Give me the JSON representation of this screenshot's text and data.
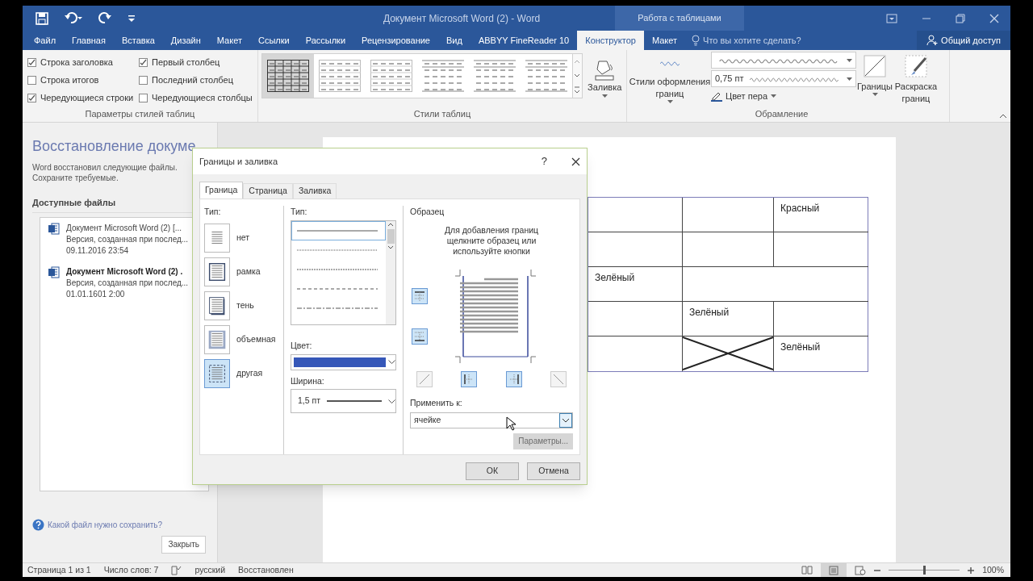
{
  "title_bar": {
    "title": "Документ Microsoft Word (2) - Word",
    "context_tab": "Работа с таблицами"
  },
  "ribbon_tabs": [
    {
      "label": "Файл",
      "selected": false
    },
    {
      "label": "Главная",
      "selected": false
    },
    {
      "label": "Вставка",
      "selected": false
    },
    {
      "label": "Дизайн",
      "selected": false
    },
    {
      "label": "Макет",
      "selected": false
    },
    {
      "label": "Ссылки",
      "selected": false
    },
    {
      "label": "Рассылки",
      "selected": false
    },
    {
      "label": "Рецензирование",
      "selected": false
    },
    {
      "label": "Вид",
      "selected": false
    },
    {
      "label": "ABBYY FineReader 10",
      "selected": false
    },
    {
      "label": "Конструктор",
      "selected": true
    },
    {
      "label": "Макет",
      "selected": false
    }
  ],
  "tell_me": "Что вы хотите сделать?",
  "share": "Общий доступ",
  "style_options": {
    "label": "Параметры стилей таблиц",
    "checkboxes": [
      {
        "label": "Строка заголовка",
        "checked": true
      },
      {
        "label": "Строка итогов",
        "checked": false
      },
      {
        "label": "Чередующиеся строки",
        "checked": true
      },
      {
        "label": "Первый столбец",
        "checked": true
      },
      {
        "label": "Последний столбец",
        "checked": false
      },
      {
        "label": "Чередующиеся столбцы",
        "checked": false
      }
    ]
  },
  "table_styles": {
    "label": "Стили таблиц",
    "items": [
      {
        "selected": true
      },
      {
        "selected": false
      },
      {
        "selected": false
      },
      {
        "selected": false
      },
      {
        "selected": false
      },
      {
        "selected": false
      }
    ]
  },
  "shading": {
    "label": "Заливка"
  },
  "borders_group": {
    "label": "Обрамление",
    "border_styles": "Стили оформления границ",
    "pen_weight": "0,75 пт",
    "pen_color": "Цвет пера",
    "borders": "Границы",
    "border_painter": "Раскраска границ"
  },
  "recovery": {
    "title": "Восстановление докуме",
    "description": "Word восстановил следующие файлы. Сохраните требуемые.",
    "files_label": "Доступные файлы",
    "files": [
      {
        "name": "Документ Microsoft Word (2)  [...",
        "detail": "Версия, созданная при послед...",
        "date": "09.11.2016 23:54",
        "selected": false
      },
      {
        "name": "Документ Microsoft Word (2) .",
        "detail": "Версия, созданная при послед...",
        "date": "01.01.1601 2:00",
        "selected": true
      }
    ],
    "help": "Какой файл нужно сохранить?",
    "close": "Закрыть"
  },
  "document_table": {
    "rows": [
      [
        {
          "kind": "plain"
        },
        {
          "kind": "plain"
        },
        {
          "kind": "plain",
          "text": "Красный"
        }
      ],
      [
        {
          "kind": "plain"
        },
        {
          "kind": "plain"
        },
        {
          "kind": "plain"
        }
      ],
      [
        {
          "kind": "plain",
          "text": "Зелёный"
        },
        {
          "kind": "wide"
        }
      ],
      [
        {
          "kind": "plain"
        },
        {
          "kind": "plain",
          "text": "Зелёный"
        },
        {
          "kind": "plain"
        }
      ],
      [
        {
          "kind": "plain"
        },
        {
          "kind": "crossed"
        },
        {
          "kind": "plain",
          "text": "Зелёный"
        }
      ]
    ]
  },
  "dialog": {
    "title": "Границы и заливка",
    "help": "?",
    "tabs": [
      {
        "label": "Граница",
        "selected": true
      },
      {
        "label": "Страница",
        "selected": false
      },
      {
        "label": "Заливка",
        "selected": false
      }
    ],
    "setting_label": "Тип:",
    "settings": [
      {
        "label": "нет",
        "kind": "none",
        "selected": false
      },
      {
        "label": "рамка",
        "kind": "box",
        "selected": false
      },
      {
        "label": "тень",
        "kind": "shadow",
        "selected": false
      },
      {
        "label": "объемная",
        "kind": "beveled",
        "selected": false
      },
      {
        "label": "другая",
        "kind": "custom",
        "selected": true
      }
    ],
    "style_label": "Тип:",
    "line_styles": [
      {
        "kind": "solid",
        "selected": true
      },
      {
        "kind": "dotted",
        "selected": false
      },
      {
        "kind": "fine",
        "selected": false
      },
      {
        "kind": "dashed",
        "selected": false
      },
      {
        "kind": "dashdot",
        "selected": false
      }
    ],
    "color_label": "Цвет:",
    "color": "#3557b8",
    "width_label": "Ширина:",
    "width": "1,5 пт",
    "preview_label": "Образец",
    "preview_hint": "Для добавления границ щелкните образец или используйте кнопки",
    "apply_label": "Применить к:",
    "apply_value": "ячейке",
    "options": "Параметры...",
    "options_disabled": true,
    "ok": "ОК",
    "cancel": "Отмена"
  },
  "status_bar": {
    "page": "Страница 1 из 1",
    "words": "Число слов: 7",
    "language": "русский",
    "state": "Восстановлен",
    "zoom": "100%",
    "zoom_slider": {
      "level": 0.5
    }
  }
}
